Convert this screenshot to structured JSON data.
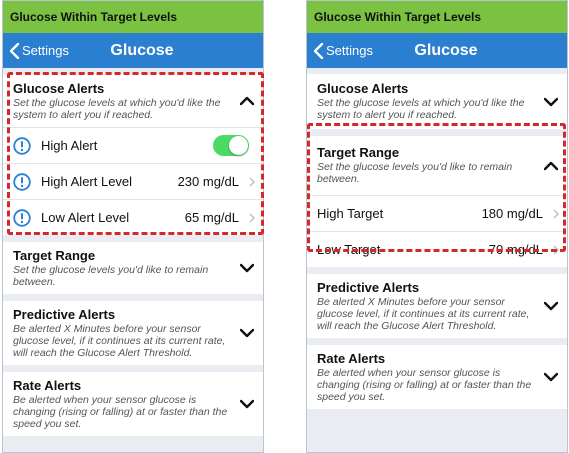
{
  "colors": {
    "topbar_bg": "#7cc242",
    "navbar_bg": "#2b7fd1",
    "highlight": "#d7262c",
    "toggle_on": "#4cd964",
    "alert_icon": "#2b7fd1"
  },
  "left": {
    "window_title": "Glucose Within Target Levels",
    "back_label": "Settings",
    "nav_title": "Glucose",
    "glucose_alerts": {
      "title": "Glucose Alerts",
      "desc": "Set the glucose levels at which you'd like the system to alert you if reached.",
      "expanded": true
    },
    "rows": [
      {
        "label": "High Alert",
        "toggle": true
      },
      {
        "label": "High Alert Level",
        "value": "230 mg/dL"
      },
      {
        "label": "Low Alert Level",
        "value": "65 mg/dL"
      }
    ],
    "target_range": {
      "title": "Target Range",
      "desc": "Set the glucose levels you'd like to remain between."
    },
    "predictive_alerts": {
      "title": "Predictive Alerts",
      "desc": "Be alerted X Minutes before your sensor glucose level, if it continues at its current rate, will reach the Glucose Alert Threshold."
    },
    "rate_alerts": {
      "title": "Rate Alerts",
      "desc": "Be alerted when your sensor glucose is changing (rising or falling) at or faster than the speed you set."
    }
  },
  "right": {
    "window_title": "Glucose Within Target Levels",
    "back_label": "Settings",
    "nav_title": "Glucose",
    "glucose_alerts": {
      "title": "Glucose Alerts",
      "desc": "Set the glucose levels at which you'd like the system to alert you if reached."
    },
    "target_range": {
      "title": "Target Range",
      "desc": "Set the glucose levels you'd like to remain between.",
      "expanded": true
    },
    "rows": [
      {
        "label": "High Target",
        "value": "180 mg/dL"
      },
      {
        "label": "Low Target",
        "value": "70 mg/dL"
      }
    ],
    "predictive_alerts": {
      "title": "Predictive Alerts",
      "desc": "Be alerted X Minutes before your sensor glucose level, if it continues at its current rate, will reach the Glucose Alert Threshold."
    },
    "rate_alerts": {
      "title": "Rate Alerts",
      "desc": "Be alerted when your sensor glucose is changing (rising or falling) at or faster than the speed you set."
    }
  }
}
